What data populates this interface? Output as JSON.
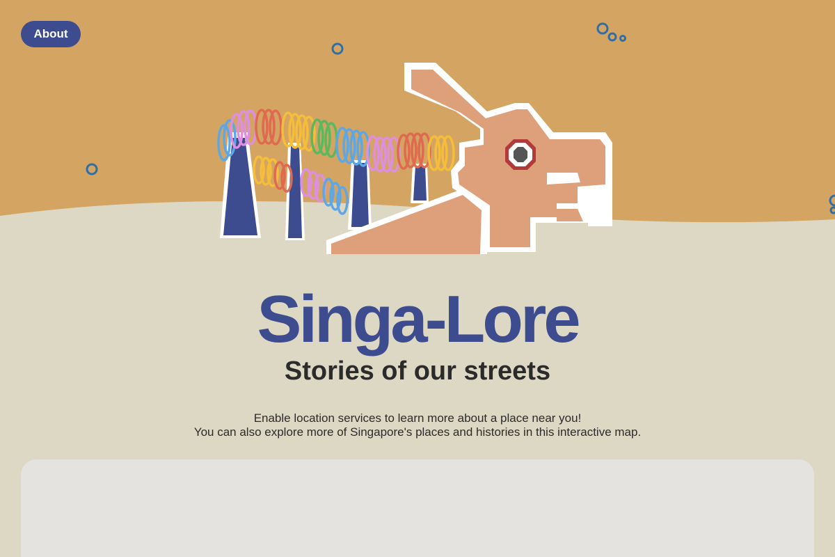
{
  "nav": {
    "about_label": "About"
  },
  "hero": {
    "title": "Singa-Lore",
    "subtitle": "Stories of our streets"
  },
  "intro": {
    "line1": "Enable location services to learn more about a place near you!",
    "line2": "You can also explore more of Singapore's places and histories in this interactive map."
  },
  "colors": {
    "sky": "#d4a462",
    "ground": "#ddd8c4",
    "accent": "#3d4c8f",
    "dragon_body": "#dea07a",
    "map_panel": "#e4e3df"
  }
}
